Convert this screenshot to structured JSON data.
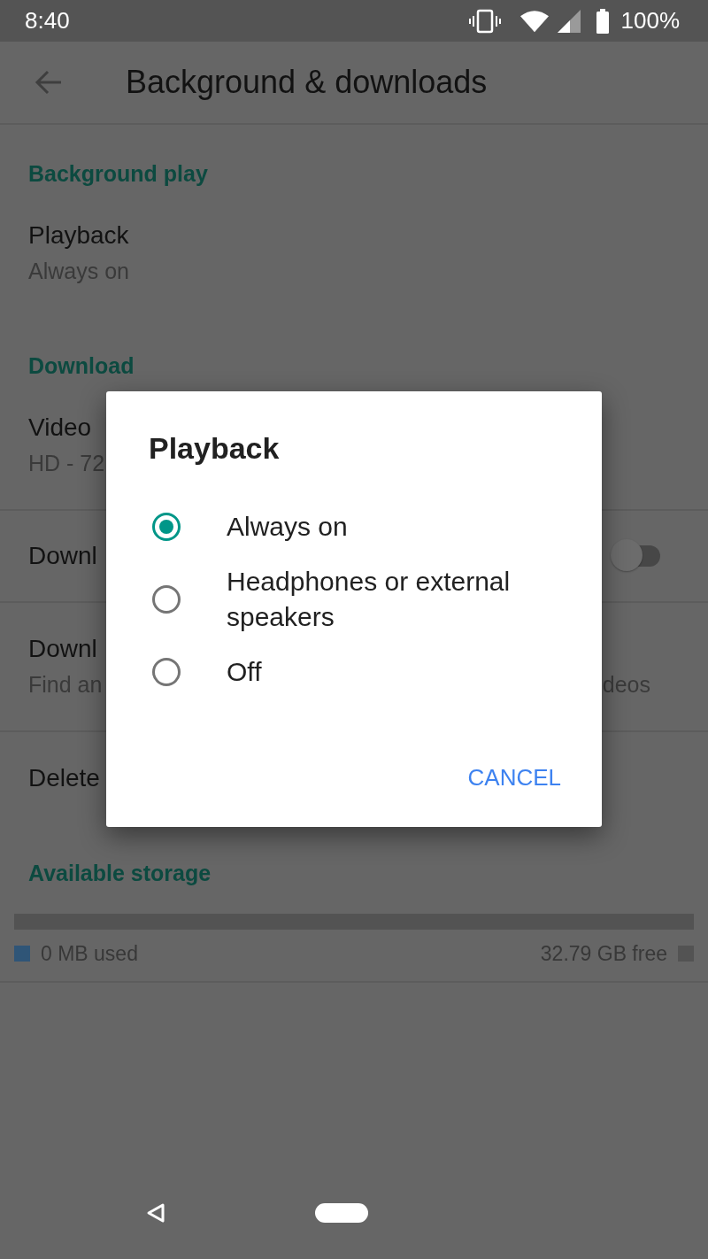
{
  "status_bar": {
    "time": "8:40",
    "battery": "100%"
  },
  "toolbar": {
    "title": "Background & downloads"
  },
  "sections": [
    {
      "header": "Background play",
      "items": [
        {
          "kind": "text",
          "title": "Playback",
          "subtitle": "Always on"
        }
      ]
    },
    {
      "header": "Download",
      "items": [
        {
          "kind": "text",
          "title": "Video",
          "subtitle": "HD - 72"
        },
        {
          "kind": "switch",
          "title": "Downl",
          "on": false
        },
        {
          "kind": "text",
          "title": "Downl",
          "subtitle": "Find an",
          "subtitle_end": "deos"
        },
        {
          "kind": "text",
          "title": "Delete"
        }
      ]
    },
    {
      "header": "Available storage",
      "storage": {
        "level": 0,
        "used": "0 MB used",
        "free": "32.79 GB free"
      }
    }
  ],
  "dialog": {
    "title": "Playback",
    "options": [
      {
        "label": "Always on",
        "selected": true
      },
      {
        "label": "Headphones or external speakers",
        "selected": false
      },
      {
        "label": "Off",
        "selected": false
      }
    ],
    "buttons": [
      "CANCEL"
    ]
  }
}
